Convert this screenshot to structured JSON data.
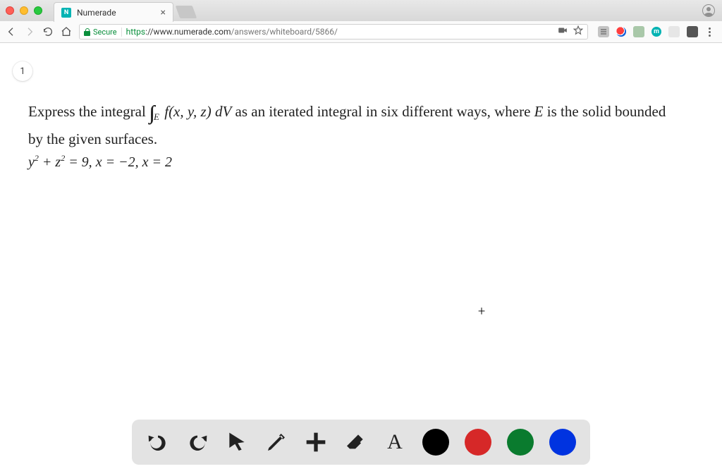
{
  "browser": {
    "tab": {
      "title": "Numerade",
      "favicon_letter": "N"
    },
    "url": {
      "secure_label": "Secure",
      "scheme": "https",
      "host": "://www.numerade.com",
      "path": "/answers/whiteboard/5866/"
    },
    "ext_letter": "m"
  },
  "page": {
    "step": "1",
    "problem": {
      "prefix": "Express the integral ",
      "int_sub": "E",
      "func": "f(x, y, z)",
      "dv": " dV",
      "mid": " as an iterated integral in six different ways, where ",
      "E": "E",
      "suffix": " is the solid bounded",
      "line2": "by the given surfaces.",
      "equation": "y² + z² = 9, x = −2, x = 2"
    },
    "cursor": "+"
  },
  "toolbar": {
    "undo": "Undo",
    "redo": "Redo",
    "pointer": "Pointer",
    "pen": "Pen",
    "add": "Add",
    "eraser": "Eraser",
    "text": "A",
    "colors": {
      "black": "#000000",
      "red": "#d62828",
      "green": "#0a7b2e",
      "blue": "#0033e0"
    }
  }
}
